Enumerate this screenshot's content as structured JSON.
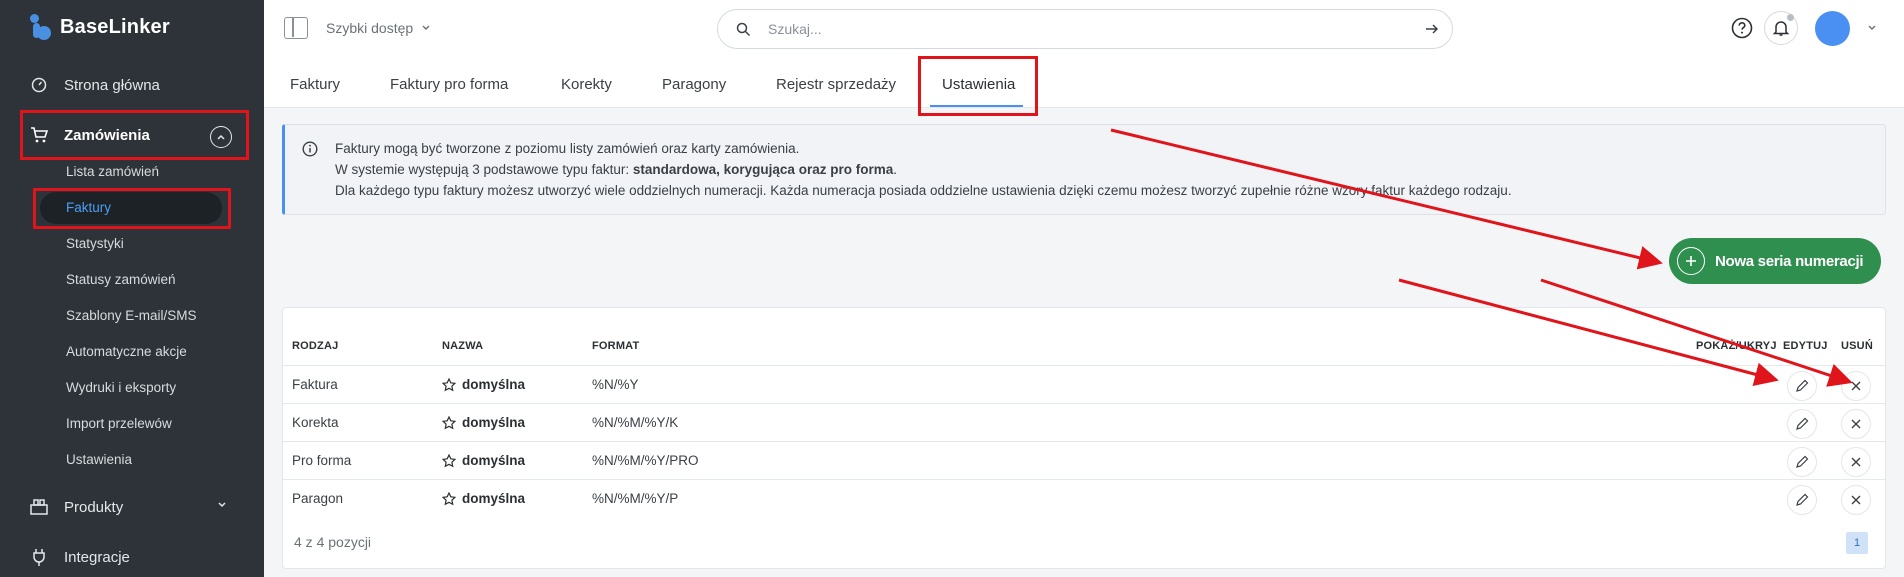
{
  "app": {
    "name": "BaseLinker"
  },
  "sidebar": {
    "items": [
      {
        "label": "Strona główna",
        "icon": "dashboard-icon"
      },
      {
        "label": "Zamówienia",
        "icon": "cart-icon"
      },
      {
        "label": "Produkty",
        "icon": "products-icon"
      },
      {
        "label": "Integracje",
        "icon": "plug-icon"
      }
    ],
    "sub_items": [
      {
        "label": "Lista zamówień"
      },
      {
        "label": "Faktury"
      },
      {
        "label": "Statystyki"
      },
      {
        "label": "Statusy zamówień"
      },
      {
        "label": "Szablony E-mail/SMS"
      },
      {
        "label": "Automatyczne akcje"
      },
      {
        "label": "Wydruki i eksporty"
      },
      {
        "label": "Import przelewów"
      },
      {
        "label": "Ustawienia"
      }
    ]
  },
  "topbar": {
    "quick_access": "Szybki dostęp",
    "search_placeholder": "Szukaj..."
  },
  "tabs": [
    {
      "label": "Faktury"
    },
    {
      "label": "Faktury pro forma"
    },
    {
      "label": "Korekty"
    },
    {
      "label": "Paragony"
    },
    {
      "label": "Rejestr sprzedaży"
    },
    {
      "label": "Ustawienia"
    }
  ],
  "info": {
    "line1": "Faktury mogą być tworzone z poziomu listy zamówień oraz karty zamówienia.",
    "line2_prefix": "W systemie występują 3 podstawowe typu faktur: ",
    "line2_bold": "standardowa, korygująca oraz pro forma",
    "line2_suffix": ".",
    "line3": "Dla każdego typu faktury możesz utworzyć wiele oddzielnych numeracji. Każda numeracja posiada oddzielne ustawienia dzięki czemu możesz tworzyć zupełnie różne wzory faktur każdego rodzaju."
  },
  "new_series_button": "Nowa seria numeracji",
  "table": {
    "headers": {
      "type": "RODZAJ",
      "name": "NAZWA",
      "format": "FORMAT",
      "show_hide": "POKAŻ/UKRYJ",
      "edit": "EDYTUJ",
      "delete": "USUŃ"
    },
    "rows": [
      {
        "type": "Faktura",
        "name": "domyślna",
        "format": "%N/%Y"
      },
      {
        "type": "Korekta",
        "name": "domyślna",
        "format": "%N/%M/%Y/K"
      },
      {
        "type": "Pro forma",
        "name": "domyślna",
        "format": "%N/%M/%Y/PRO"
      },
      {
        "type": "Paragon",
        "name": "domyślna",
        "format": "%N/%M/%Y/P"
      }
    ],
    "footer_count": "4 z 4 pozycji",
    "page": "1"
  },
  "colors": {
    "sidebar_bg": "#2d3338",
    "accent": "#4a8ff2",
    "green_button": "#2f8f4e",
    "highlight_red": "#e0141b"
  }
}
